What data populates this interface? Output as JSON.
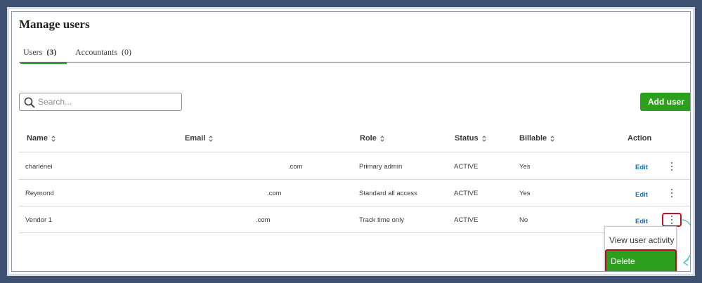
{
  "page": {
    "title": "Manage users"
  },
  "tabs": [
    {
      "label": "Users",
      "count": "(3)"
    },
    {
      "label": "Accountants",
      "count": "(0)"
    }
  ],
  "search": {
    "placeholder": "Search...",
    "value": ""
  },
  "add_user_label": "Add user",
  "table": {
    "columns": [
      "Name",
      "Email",
      "Role",
      "Status",
      "Billable",
      "Action"
    ],
    "rows": [
      {
        "name": "charlenei",
        "email": ".com",
        "role": "Primary admin",
        "status": "ACTIVE",
        "billable": "Yes",
        "action": "Edit"
      },
      {
        "name": "Reymond",
        "email": ".com",
        "role": "Standard all access",
        "status": "ACTIVE",
        "billable": "Yes",
        "action": "Edit"
      },
      {
        "name": "Vendor 1",
        "email": ".com",
        "role": "Track time only",
        "status": "ACTIVE",
        "billable": "No",
        "action": "Edit"
      }
    ]
  },
  "row_menu": {
    "items": [
      "View user activity",
      "Delete"
    ]
  },
  "colors": {
    "accent_green": "#2ca01c",
    "link_blue": "#0077c5",
    "highlight_red": "#c0101f",
    "outer_bg": "#3f5173"
  },
  "icons": [
    "search-icon",
    "sort-icon",
    "more-options-icon",
    "curved-arrow-icon"
  ]
}
